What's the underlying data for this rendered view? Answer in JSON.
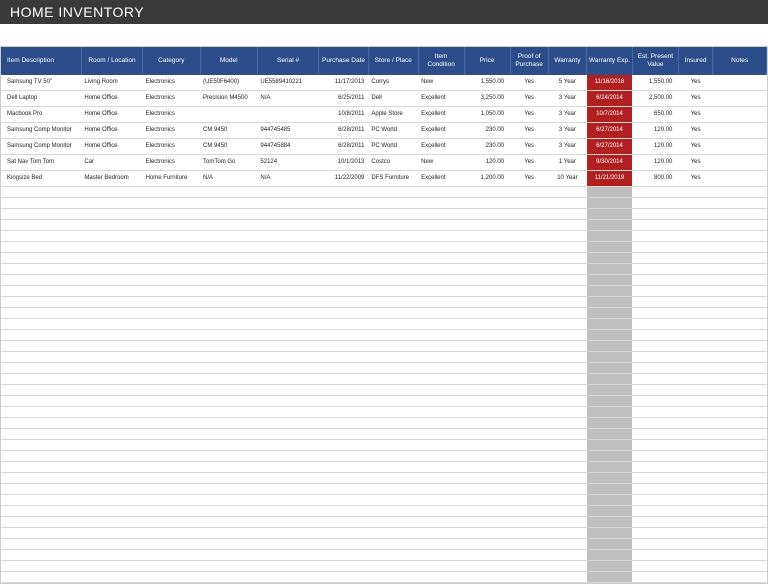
{
  "title": "HOME INVENTORY",
  "columns": [
    "Item Description",
    "Room / Location",
    "Category",
    "Model",
    "Serial #",
    "Purchase Date",
    "Store / Place",
    "Item Condition",
    "Price",
    "Proof of Purchase",
    "Warranty",
    "Warranty Exp.",
    "Est. Present Value",
    "Insured",
    "Notes"
  ],
  "rows": [
    {
      "desc": "Samsung TV 50\"",
      "room": "Living Room",
      "cat": "Electronics",
      "model": "(UE50F6400)",
      "serial": "UE5589410221",
      "pdate": "11/17/2013",
      "store": "Currys",
      "cond": "New",
      "price": "1,550.00",
      "proof": "Yes",
      "warranty": "5 Year",
      "wexp": "11/16/2018",
      "val": "1,550.00",
      "ins": "Yes",
      "notes": "",
      "wexpAlert": true
    },
    {
      "desc": "Dell Laptop",
      "room": "Home Office",
      "cat": "Electronics",
      "model": "Precision M4500",
      "serial": "N/A",
      "pdate": "6/25/2011",
      "store": "Dell",
      "cond": "Excellent",
      "price": "3,250.00",
      "proof": "Yes",
      "warranty": "3 Year",
      "wexp": "6/24/2014",
      "val": "2,500.00",
      "ins": "Yes",
      "notes": "",
      "wexpAlert": true
    },
    {
      "desc": "Macbook Pro",
      "room": "Home Office",
      "cat": "Electronics",
      "model": "",
      "serial": "",
      "pdate": "10/8/2011",
      "store": "Apple Store",
      "cond": "Excellent",
      "price": "1,050.00",
      "proof": "Yes",
      "warranty": "3 Year",
      "wexp": "10/7/2014",
      "val": "650.00",
      "ins": "Yes",
      "notes": "",
      "wexpAlert": true
    },
    {
      "desc": "Samsung Comp Monitor",
      "room": "Home Office",
      "cat": "Electronics",
      "model": "CM 9450",
      "serial": "944745485",
      "pdate": "6/28/2011",
      "store": "PC World",
      "cond": "Excellent",
      "price": "230.00",
      "proof": "Yes",
      "warranty": "3 Year",
      "wexp": "6/27/2014",
      "val": "120.00",
      "ins": "Yes",
      "notes": "",
      "wexpAlert": true
    },
    {
      "desc": "Samsung Comp Monitor",
      "room": "Home Office",
      "cat": "Electronics",
      "model": "CM 9450",
      "serial": "944745884",
      "pdate": "6/28/2011",
      "store": "PC World",
      "cond": "Excellent",
      "price": "230.00",
      "proof": "Yes",
      "warranty": "3 Year",
      "wexp": "6/27/2014",
      "val": "120.00",
      "ins": "Yes",
      "notes": "",
      "wexpAlert": true
    },
    {
      "desc": "Sat Nav Tom Tom",
      "room": "Car",
      "cat": "Electronics",
      "model": "TomTom Go",
      "serial": "52124",
      "pdate": "10/1/2013",
      "store": "Costco",
      "cond": "New",
      "price": "120.00",
      "proof": "Yes",
      "warranty": "1 Year",
      "wexp": "9/30/2014",
      "val": "120.00",
      "ins": "Yes",
      "notes": "",
      "wexpAlert": true
    },
    {
      "desc": "Kingsize Bed",
      "room": "Master Bedroom",
      "cat": "Home Furniture",
      "model": "N/A",
      "serial": "N/A",
      "pdate": "11/22/2009",
      "store": "DFS Furniture",
      "cond": "Excellent",
      "price": "1,200.00",
      "proof": "Yes",
      "warranty": "10 Year",
      "wexp": "11/21/2019",
      "val": "800.00",
      "ins": "Yes",
      "notes": "",
      "wexpAlert": true
    }
  ],
  "emptyRowsCount": 36
}
